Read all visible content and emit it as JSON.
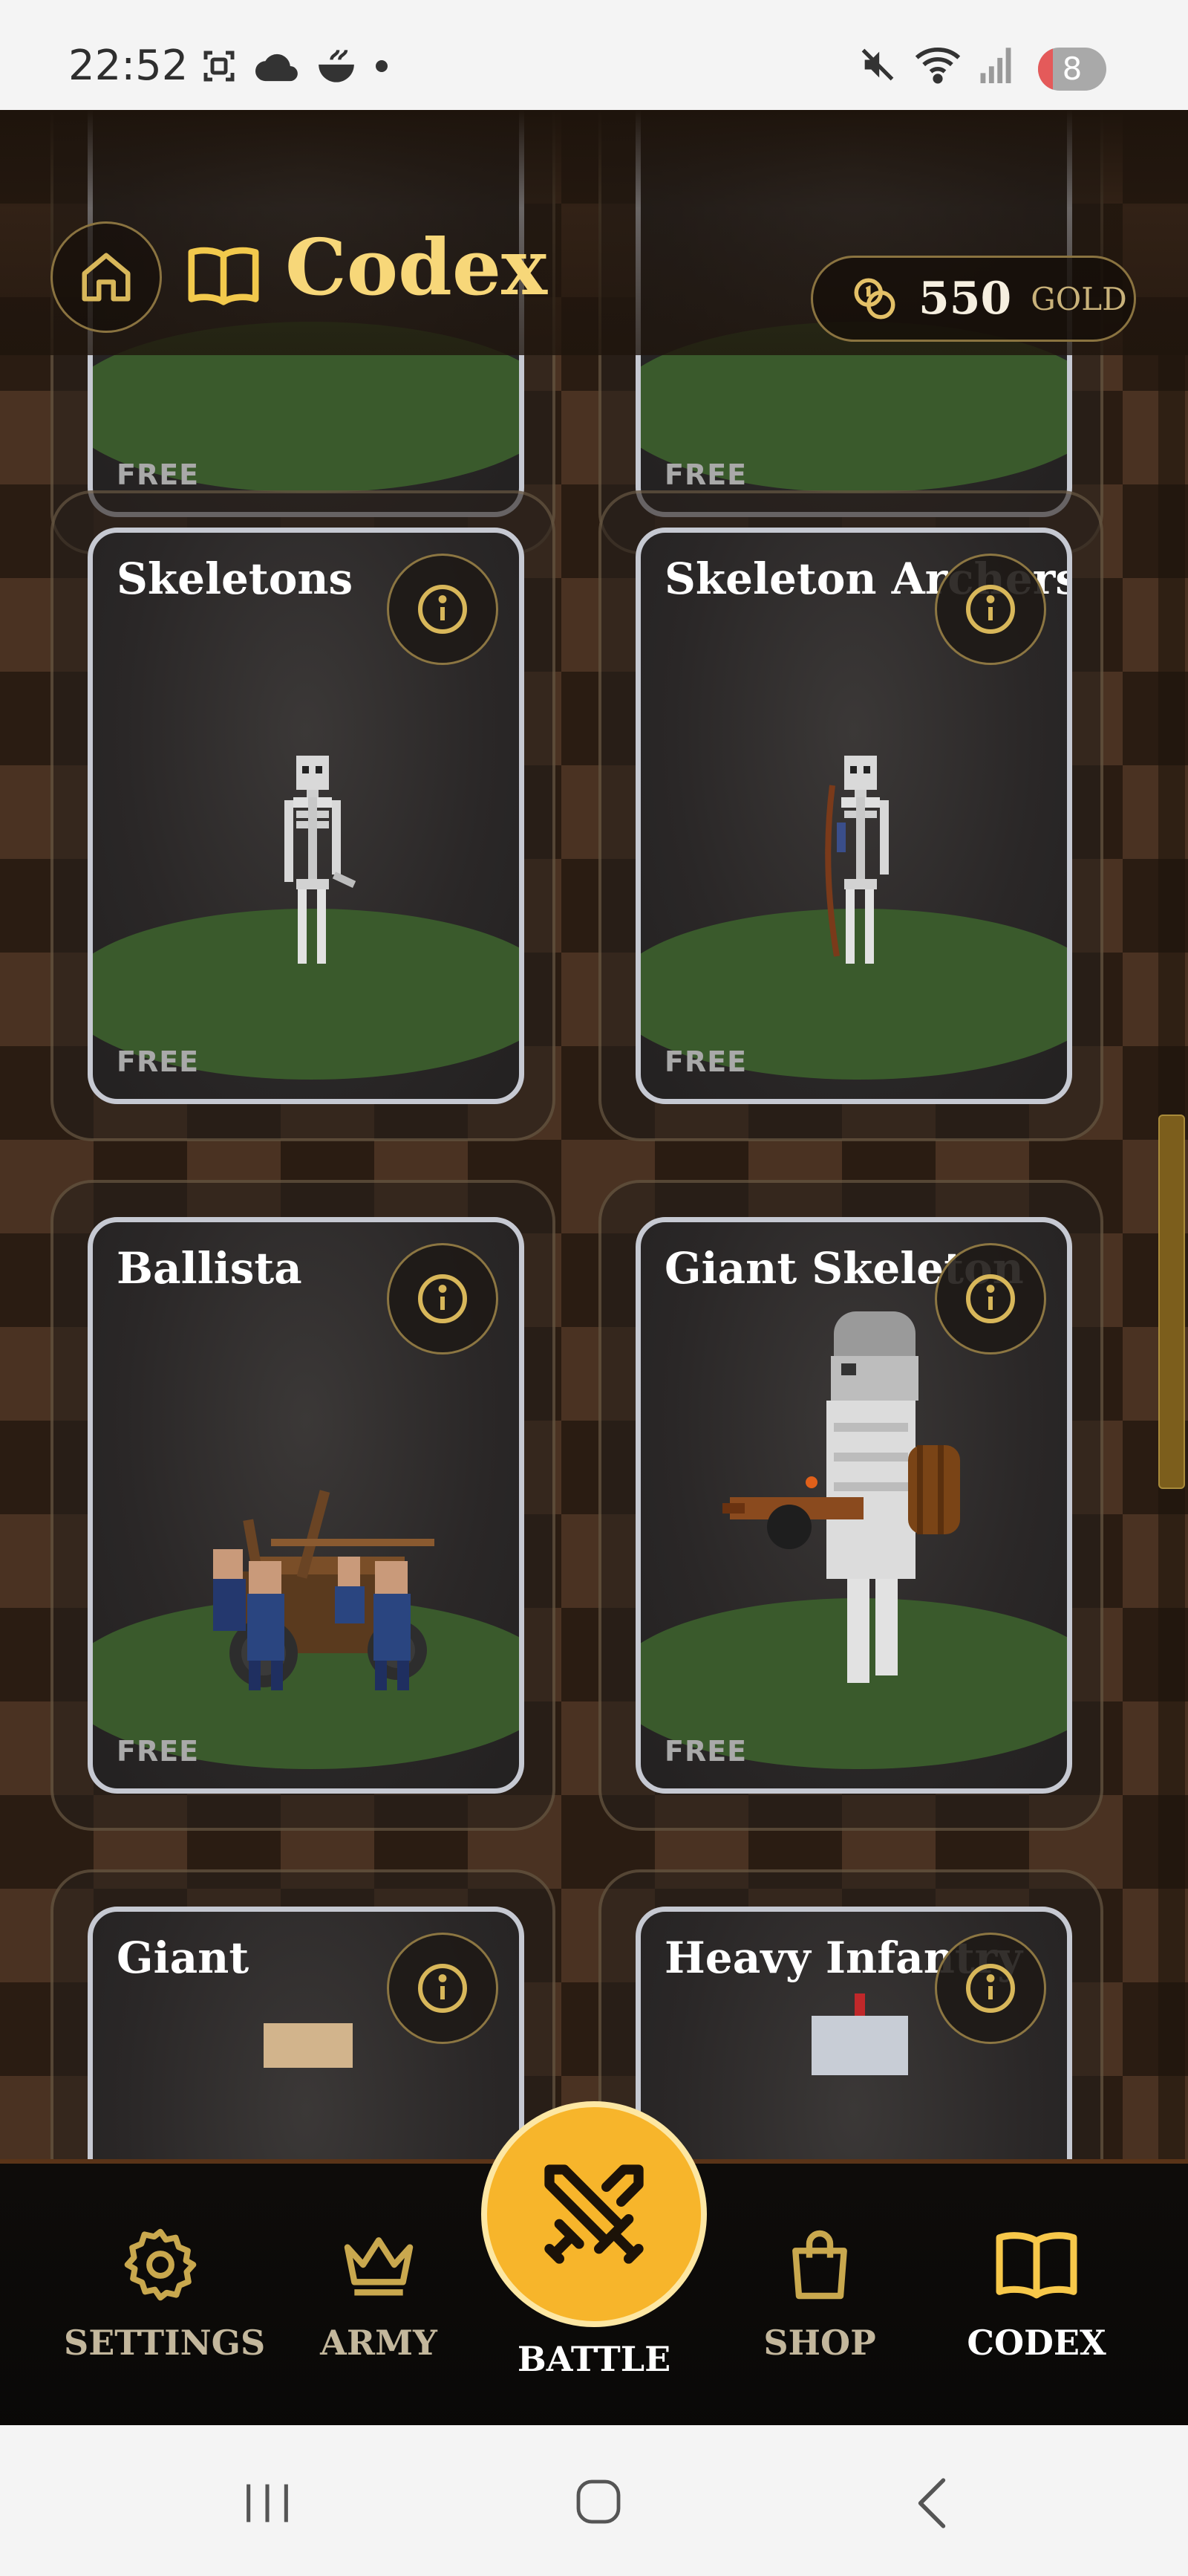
{
  "status_bar": {
    "time": "22:52",
    "battery": "8",
    "left_icons": [
      "screenshot-icon",
      "cloud-icon",
      "bowl-icon",
      "dot-icon"
    ],
    "right_icons": [
      "mute-icon",
      "wifi-icon",
      "signal-icon",
      "battery-icon"
    ]
  },
  "header": {
    "title": "Codex",
    "gold_amount": "550",
    "gold_label": "GOLD"
  },
  "cards": [
    {
      "name": "",
      "price": "FREE"
    },
    {
      "name": "",
      "price": "FREE"
    },
    {
      "name": "Skeletons",
      "price": "FREE"
    },
    {
      "name": "Skeleton Archers",
      "price": "FREE"
    },
    {
      "name": "Ballista",
      "price": "FREE"
    },
    {
      "name": "Giant Skeleton",
      "price": "FREE"
    },
    {
      "name": "Giant",
      "price": ""
    },
    {
      "name": "Heavy Infantry",
      "price": ""
    }
  ],
  "nav": {
    "settings": "SETTINGS",
    "army": "ARMY",
    "battle": "BATTLE",
    "shop": "SHOP",
    "codex": "CODEX",
    "active": "codex"
  },
  "colors": {
    "accent_gold": "#f7b52b",
    "title_gold": "#f7d779",
    "icon_gold": "#d8b75a"
  }
}
